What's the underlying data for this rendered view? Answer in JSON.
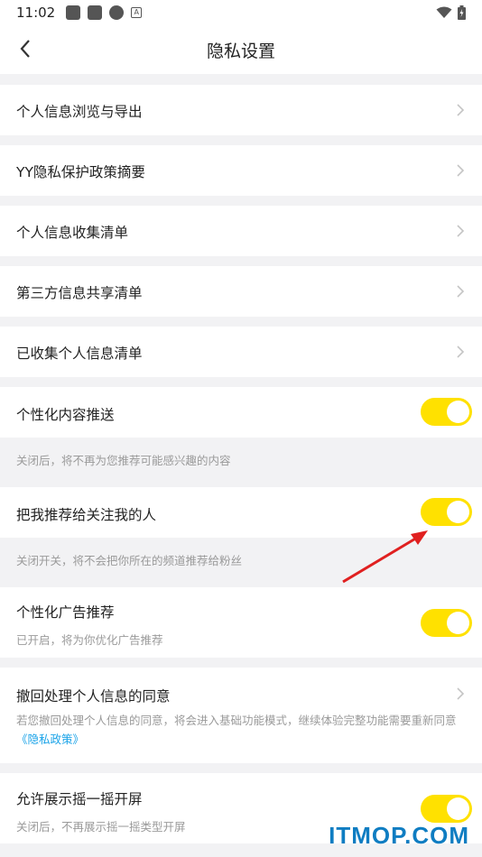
{
  "status_bar": {
    "time": "11:02",
    "badge": "A"
  },
  "header": {
    "title": "隐私设置"
  },
  "links": [
    {
      "label": "个人信息浏览与导出"
    },
    {
      "label": "YY隐私保护政策摘要"
    },
    {
      "label": "个人信息收集清单"
    },
    {
      "label": "第三方信息共享清单"
    },
    {
      "label": "已收集个人信息清单"
    }
  ],
  "toggles": [
    {
      "label": "个性化内容推送",
      "description": "关闭后，将不再为您推荐可能感兴趣的内容",
      "on": true
    },
    {
      "label": "把我推荐给关注我的人",
      "description": "关闭开关，将不会把你所在的频道推荐给粉丝",
      "on": true
    },
    {
      "label": "个性化广告推荐",
      "description": "已开启，将为你优化广告推荐",
      "on": true
    }
  ],
  "withdraw": {
    "label": "撤回处理个人信息的同意",
    "description": "若您撤回处理个人信息的同意，将会进入基础功能模式，继续体验完整功能需要重新同意",
    "policy_link": "《隐私政策》"
  },
  "shake": {
    "label": "允许展示摇一摇开屏",
    "description": "关闭后，不再展示摇一摇类型开屏",
    "on": true
  },
  "colors": {
    "toggle_on": "#ffe100",
    "link": "#1aa3e8",
    "arrow": "#e02020"
  },
  "watermark": "ITMOP.COM"
}
